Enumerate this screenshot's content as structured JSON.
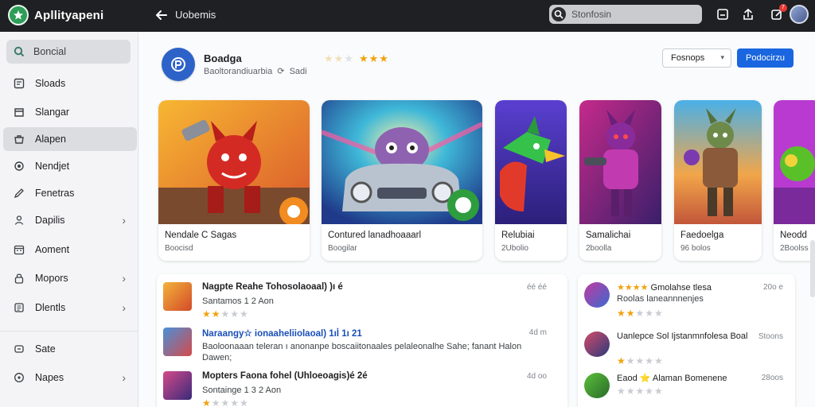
{
  "app": {
    "title": "Apllityapeni"
  },
  "topbar": {
    "title": "Uobemis",
    "search_placeholder": "Stonfosin",
    "notification_count": "7"
  },
  "sidebar": {
    "search_label": "Boncial",
    "items": [
      {
        "label": "Sloads",
        "icon": "download-icon"
      },
      {
        "label": "Slangar",
        "icon": "bookmark-icon"
      },
      {
        "label": "Alapen",
        "icon": "store-icon",
        "active": true
      },
      {
        "label": "Nendjet",
        "icon": "circle-icon"
      },
      {
        "label": "Fenetras",
        "icon": "edit-icon"
      },
      {
        "label": "Dapilis",
        "icon": "user-icon",
        "chevron": true
      },
      {
        "label": "Aoment",
        "icon": "calendar-icon"
      },
      {
        "label": "Mopors",
        "icon": "lock-icon",
        "chevron": true
      },
      {
        "label": "Dlentls",
        "icon": "folder-icon",
        "chevron": true
      }
    ],
    "bottom_items": [
      {
        "label": "Sate",
        "icon": "settings-icon"
      },
      {
        "label": "Napes",
        "icon": "help-icon",
        "chevron": true
      }
    ]
  },
  "header": {
    "title": "Boadga",
    "subtitle": "Baoltorandiuarbia",
    "subtitle_suffix": "Sadi",
    "stars_gold": 3,
    "stars_faint": 2,
    "sort_label": "Fosnops",
    "primary_button": "Podocirzu"
  },
  "cards": [
    {
      "name": "Nendale C Sagas",
      "meta": "Boocisd"
    },
    {
      "name": "Contured lanadhoaaarl",
      "meta": "Boogilar"
    },
    {
      "name": "Relubiai",
      "meta": "2Ubolio"
    },
    {
      "name": "Samalichai",
      "meta": "2boolla"
    },
    {
      "name": "Faedoelga",
      "meta": "96 bolos"
    },
    {
      "name": "Neodd",
      "meta": "2Boolss"
    }
  ],
  "reviews": [
    {
      "name": "Nagpte Reahe Tohosolaoaal) )ı é",
      "time": "éé éé",
      "body": "Santamos 1 2 Aon",
      "stars": 2,
      "blue": false
    },
    {
      "name": "Naraangy☆ ionaaheliiolaoal) 1ıİ 1ı 21",
      "time": "4d m",
      "body": "Baoloonaaan teleran ı anonanpe boscaiitonaales pelaleonalhe Sahe; fanant Halon Dawen;",
      "stars": 2,
      "blue": true
    },
    {
      "name": "Mopters Faona fohel (Uhloeoagis)é 2é",
      "time": "4d oo",
      "body": "Sontainge 1 3 2 Aon",
      "stars": 1,
      "blue": false
    }
  ],
  "side_reviews": [
    {
      "name": "Gmolahse tlesa",
      "time": "20o e",
      "body": "Roolas laneannnenjes",
      "stars": 2
    },
    {
      "name": "Uanlepce Sol Ijstanmnfolesa Boal",
      "time": "Stoons",
      "body": "",
      "stars": 1
    },
    {
      "name": "Eaod ⭐ Alaman Bomenene",
      "time": "28oos",
      "body": "",
      "stars": 0
    }
  ],
  "colors": {
    "accent": "#1a66e0",
    "topbar": "#1f2023",
    "star": "#f2a20c"
  }
}
